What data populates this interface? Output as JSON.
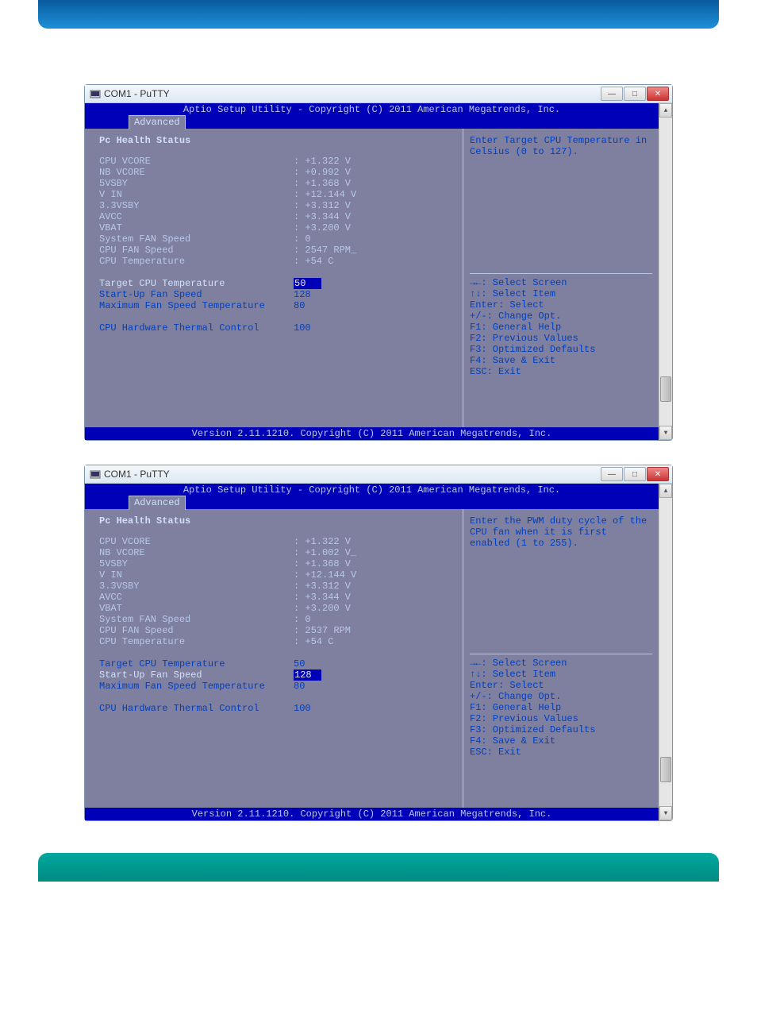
{
  "window_title": "COM1 - PuTTY",
  "bios_header": "Aptio Setup Utility - Copyright (C) 2011 American Megatrends, Inc.",
  "bios_footer": "Version 2.11.1210. Copyright (C) 2011 American Megatrends, Inc.",
  "tab_label": "Advanced",
  "section_title": "Pc Health Status",
  "readings": [
    {
      "label": "CPU VCORE",
      "value": ": +1.322 V"
    },
    {
      "label": "NB VCORE",
      "value": ": +0.992 V"
    },
    {
      "label": "5VSBY",
      "value": ": +1.368 V"
    },
    {
      "label": "V IN",
      "value": ": +12.144 V"
    },
    {
      "label": "3.3VSBY",
      "value": ": +3.312 V"
    },
    {
      "label": "AVCC",
      "value": ": +3.344 V"
    },
    {
      "label": "VBAT",
      "value": ": +3.200 V"
    },
    {
      "label": "System FAN Speed",
      "value": ": 0"
    },
    {
      "label": "CPU FAN Speed",
      "value": ": 2547 RPM_"
    },
    {
      "label": "CPU Temperature",
      "value": ": +54 C"
    }
  ],
  "settings": [
    {
      "label": "Target CPU Temperature",
      "value": "50"
    },
    {
      "label": "Start-Up Fan Speed",
      "value": "128"
    },
    {
      "label": "Maximum Fan Speed Temperature",
      "value": "80"
    }
  ],
  "extra_setting": {
    "label": "CPU Hardware Thermal Control",
    "value": "100"
  },
  "help1": "Enter Target CPU Temperature in Celsius (0 to 127).",
  "nav_hints": [
    "→←: Select Screen",
    "↑↓: Select Item",
    "Enter: Select",
    "+/-: Change Opt.",
    "F1: General Help",
    "F2: Previous Values",
    "F3: Optimized Defaults",
    "F4: Save & Exit",
    "ESC: Exit"
  ],
  "readings2": [
    {
      "label": "CPU VCORE",
      "value": ": +1.322 V"
    },
    {
      "label": "NB VCORE",
      "value": ": +1.002 V_"
    },
    {
      "label": "5VSBY",
      "value": ": +1.368 V"
    },
    {
      "label": "V IN",
      "value": ": +12.144 V"
    },
    {
      "label": "3.3VSBY",
      "value": ": +3.312 V"
    },
    {
      "label": "AVCC",
      "value": ": +3.344 V"
    },
    {
      "label": "VBAT",
      "value": ": +3.200 V"
    },
    {
      "label": "System FAN Speed",
      "value": ": 0"
    },
    {
      "label": "CPU FAN Speed",
      "value": ": 2537 RPM"
    },
    {
      "label": "CPU Temperature",
      "value": ": +54 C"
    }
  ],
  "help2": "Enter the PWM duty cycle of the CPU fan when it is first enabled (1 to 255)."
}
